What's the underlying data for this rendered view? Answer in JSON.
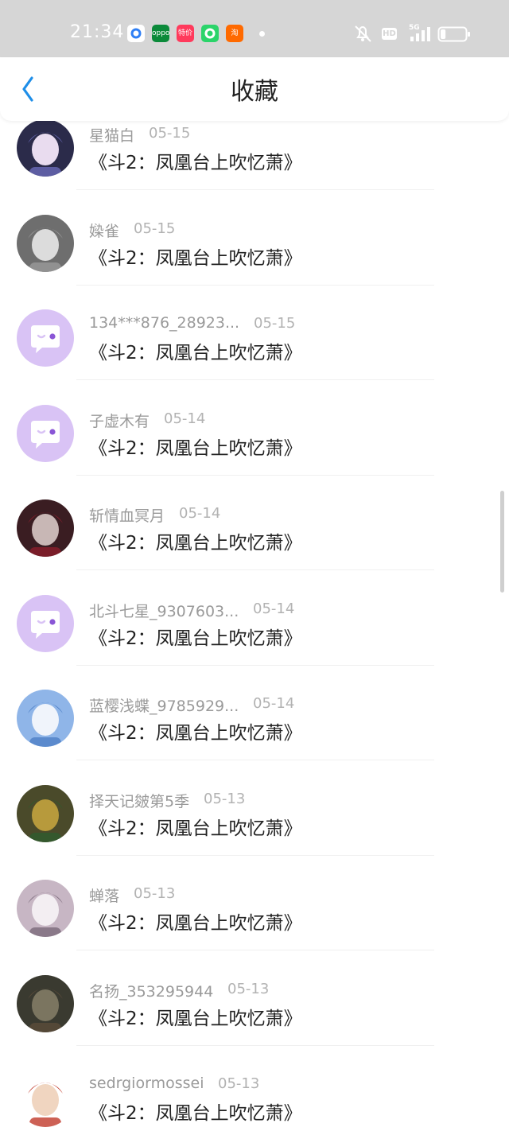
{
  "status_bar": {
    "time": "21:34",
    "apps": [
      {
        "icon": "generic-app-icon",
        "color": "#2f7ff5",
        "text": "",
        "bg": "#ffffff"
      },
      {
        "icon": "oppo-app-icon",
        "color": "#ffffff",
        "text": "oppo",
        "bg": "#0b8a3a"
      },
      {
        "icon": "taobao-special-icon",
        "color": "#ffffff",
        "text": "特价",
        "bg": "#ff3a5c"
      },
      {
        "icon": "shopping-bag-app-icon",
        "color": "#ffffff",
        "text": "",
        "bg": "#2bd46a"
      },
      {
        "icon": "taobao-icon",
        "color": "#ffffff",
        "text": "淘",
        "bg": "#ff6a00"
      }
    ],
    "hd": "HD",
    "network": "5G",
    "battery_level": 0.2
  },
  "header": {
    "back_icon": "chevron-left-icon",
    "title": "收藏",
    "accent": "#1e8ee8"
  },
  "favorites": [
    {
      "user": "星猫白",
      "date": "05-15",
      "title": "《斗2：凤凰台上吹忆萧》",
      "avatar": "photo"
    },
    {
      "user": "媣雀",
      "date": "05-15",
      "title": "《斗2：凤凰台上吹忆萧》",
      "avatar": "photo"
    },
    {
      "user": "134***876_28923...",
      "date": "05-15",
      "title": "《斗2：凤凰台上吹忆萧》",
      "avatar": "default"
    },
    {
      "user": "子虚木有",
      "date": "05-14",
      "title": "《斗2：凤凰台上吹忆萧》",
      "avatar": "default"
    },
    {
      "user": "斩情血冥月",
      "date": "05-14",
      "title": "《斗2：凤凰台上吹忆萧》",
      "avatar": "photo"
    },
    {
      "user": "北斗七星_9307603...",
      "date": "05-14",
      "title": "《斗2：凤凰台上吹忆萧》",
      "avatar": "default"
    },
    {
      "user": "蓝樱浅蝶_9785929...",
      "date": "05-14",
      "title": "《斗2：凤凰台上吹忆萧》",
      "avatar": "photo"
    },
    {
      "user": "择天记皴第5季",
      "date": "05-13",
      "title": "《斗2：凤凰台上吹忆萧》",
      "avatar": "photo"
    },
    {
      "user": "蝉落",
      "date": "05-13",
      "title": "《斗2：凤凰台上吹忆萧》",
      "avatar": "photo"
    },
    {
      "user": "名扬_353295944",
      "date": "05-13",
      "title": "《斗2：凤凰台上吹忆萧》",
      "avatar": "photo"
    },
    {
      "user": "sedrgiormossei",
      "date": "05-13",
      "title": "《斗2：凤凰台上吹忆萧》",
      "avatar": "photo"
    }
  ],
  "colors": {
    "default_avatar_bg": "#d9c3f5",
    "default_avatar_eye": "#8a56d6",
    "status_bar_bg": "#d6d6d6"
  }
}
